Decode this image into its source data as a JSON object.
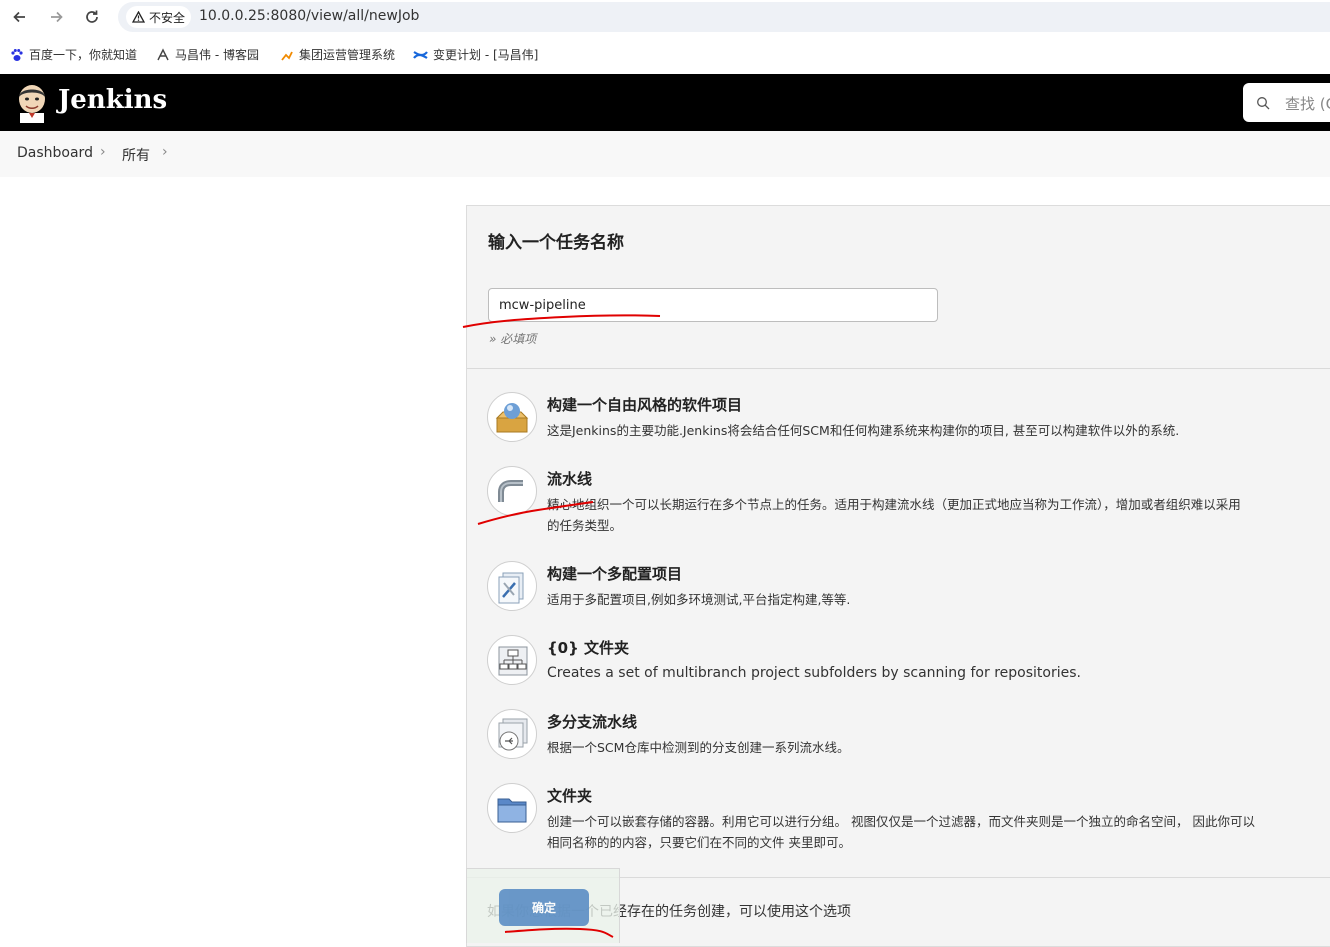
{
  "browser": {
    "security_label": "不安全",
    "url": "10.0.0.25:8080/view/all/newJob",
    "bookmarks": [
      "百度一下，你就知道",
      "马昌伟 - 博客园",
      "集团运营管理系统",
      "变更计划 - [马昌伟]"
    ]
  },
  "header": {
    "brand": "Jenkins",
    "search_placeholder": "查找 (C"
  },
  "breadcrumb": [
    "Dashboard",
    "所有"
  ],
  "form": {
    "title": "输入一个任务名称",
    "job_name_value": "mcw-pipeline",
    "required_hint": "» 必填项"
  },
  "job_types": [
    {
      "name": "构建一个自由风格的软件项目",
      "desc": "这是Jenkins的主要功能.Jenkins将会结合任何SCM和任何构建系统来构建你的项目, 甚至可以构建软件以外的系统.",
      "icon": "freestyle-icon"
    },
    {
      "name": "流水线",
      "desc": "精心地组织一个可以长期运行在多个节点上的任务。适用于构建流水线（更加正式地应当称为工作流），增加或者组织难以采用",
      "desc2": "的任务类型。",
      "icon": "pipeline-icon"
    },
    {
      "name": "构建一个多配置项目",
      "desc": "适用于多配置项目,例如多环境测试,平台指定构建,等等.",
      "icon": "multiconfig-icon"
    },
    {
      "name": "{0} 文件夹",
      "desc": "Creates a set of multibranch project subfolders by scanning for repositories.",
      "icon": "org-folder-icon"
    },
    {
      "name": "多分支流水线",
      "desc": "根据一个SCM仓库中检测到的分支创建一系列流水线。",
      "icon": "multibranch-icon"
    },
    {
      "name": "文件夹",
      "desc": "创建一个可以嵌套存储的容器。利用它可以进行分组。 视图仅仅是一个过滤器，而文件夹则是一个独立的命名空间， 因此你可以",
      "desc2": "相同名称的的内容，只要它们在不同的文件 夹里即可。",
      "icon": "folder-icon"
    }
  ],
  "copy_hint": "如果你想根据一个已经存在的任务创建，可以使用这个选项",
  "ok_button": "确定",
  "colors": {
    "header_bg": "#000000",
    "panel_bg": "#f4f4f4",
    "button": "#5b8ec4",
    "annotation": "#e00000"
  }
}
